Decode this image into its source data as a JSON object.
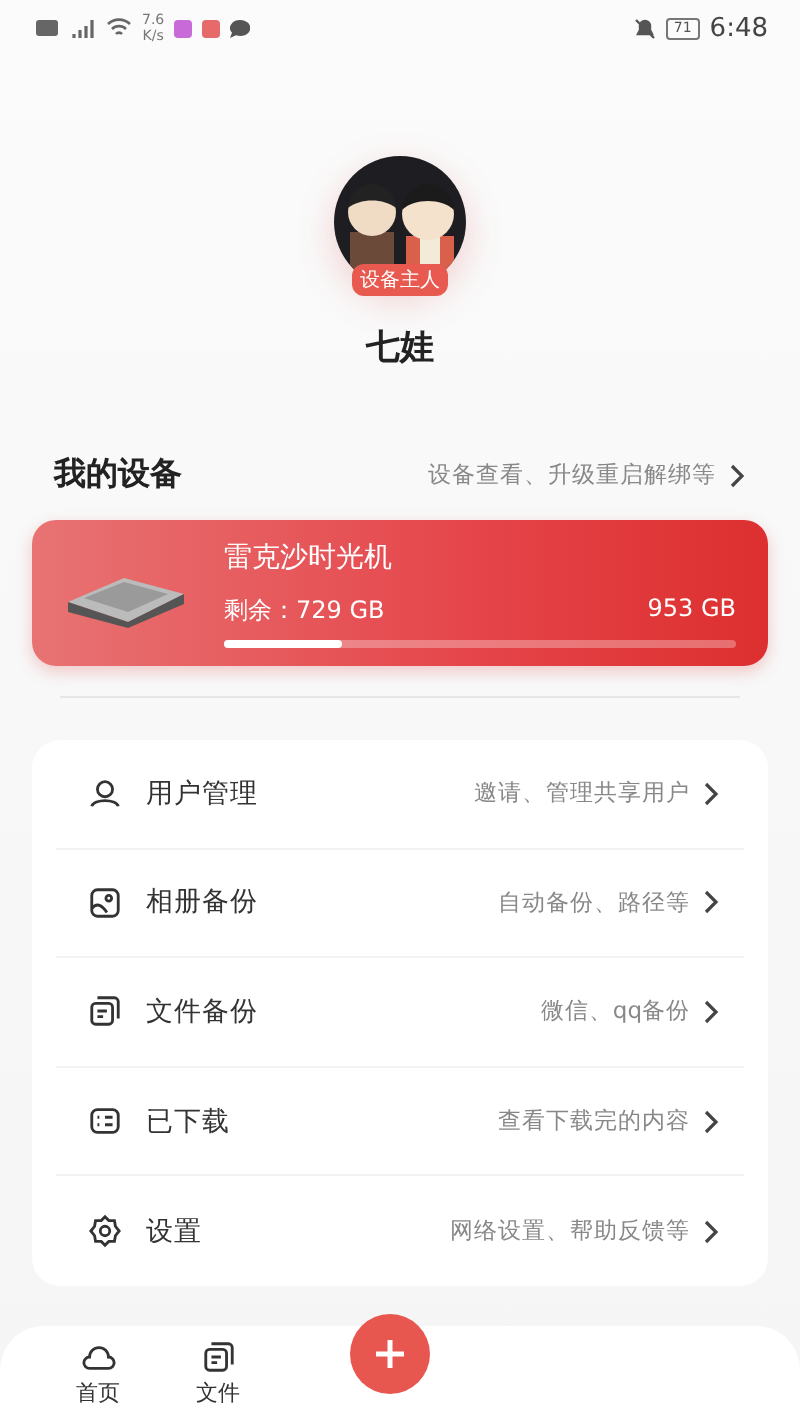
{
  "status_bar": {
    "speed_value": "7.6",
    "speed_unit": "K/s",
    "battery": "71",
    "time": "6:48"
  },
  "profile": {
    "badge": "设备主人",
    "name": "七娃"
  },
  "devices": {
    "title": "我的设备",
    "hint": "设备查看、升级重启解绑等",
    "device": {
      "name": "雷克沙时光机",
      "free": "剩余：729 GB",
      "total": "953 GB",
      "level": 0.23
    }
  },
  "menu": [
    {
      "kind": "user",
      "label": "用户管理",
      "hint": "邀请、管理共享用户"
    },
    {
      "kind": "album",
      "label": "相册备份",
      "hint": "自动备份、路径等"
    },
    {
      "kind": "files",
      "label": "文件备份",
      "hint": "微信、qq备份"
    },
    {
      "kind": "download",
      "label": "已下载",
      "hint": "查看下载完的内容"
    },
    {
      "kind": "settings",
      "label": "设置",
      "hint": "网络设置、帮助反馈等"
    }
  ],
  "nav": [
    {
      "kind": "home",
      "label": "首页"
    },
    {
      "kind": "files",
      "label": "文件"
    }
  ]
}
